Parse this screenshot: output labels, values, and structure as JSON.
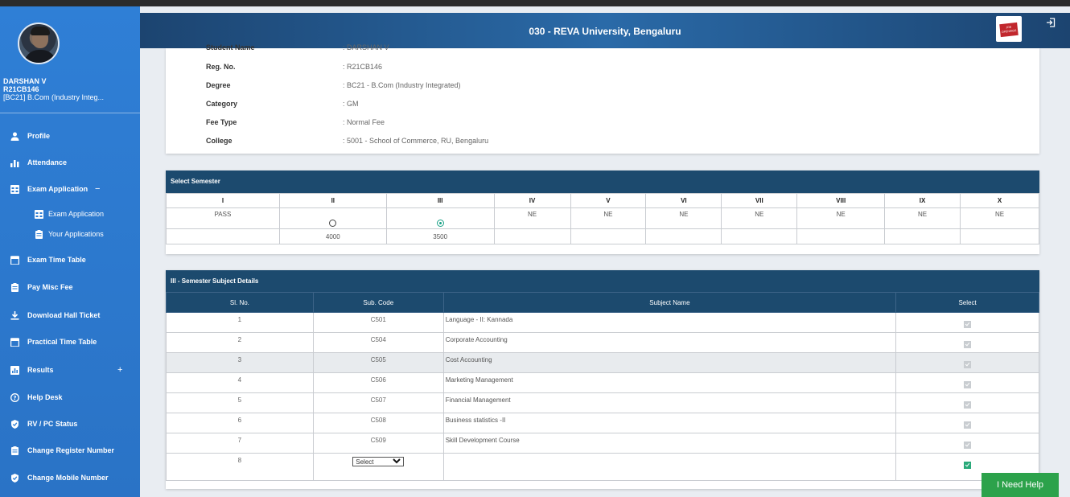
{
  "header": {
    "title": "030 - REVA University, Bengaluru",
    "job_badge": "JOB OPENINGS"
  },
  "user": {
    "name": "DARSHAN V",
    "reg_no": "R21CB146",
    "program": "[BC21] B.Com (Industry Integ..."
  },
  "nav": [
    {
      "label": "Profile",
      "icon": "person-icon"
    },
    {
      "label": "Attendance",
      "icon": "bar-chart-icon"
    },
    {
      "label": "Exam Application",
      "icon": "calendar-grid-icon",
      "toggle": "−"
    },
    {
      "label": "Exam Application",
      "icon": "calendar-grid-icon"
    },
    {
      "label": "Your Applications",
      "icon": "clipboard-icon"
    },
    {
      "label": "Exam Time Table",
      "icon": "calendar-icon"
    },
    {
      "label": "Pay Misc Fee",
      "icon": "clipboard-icon"
    },
    {
      "label": "Download Hall Ticket",
      "icon": "download-icon"
    },
    {
      "label": "Practical Time Table",
      "icon": "calendar-icon"
    },
    {
      "label": "Results",
      "icon": "chart-box-icon",
      "toggle": "+"
    },
    {
      "label": "Help Desk",
      "icon": "question-icon"
    },
    {
      "label": "RV / PC Status",
      "icon": "shield-check-icon"
    },
    {
      "label": "Change Register Number",
      "icon": "clipboard-icon"
    },
    {
      "label": "Change Mobile Number",
      "icon": "shield-check-icon"
    }
  ],
  "student": {
    "rows": [
      {
        "label": "Student Name",
        "value": ": DARSHAN V"
      },
      {
        "label": "Reg. No.",
        "value": ": R21CB146"
      },
      {
        "label": "Degree",
        "value": ": BC21 - B.Com (Industry Integrated)"
      },
      {
        "label": "Category",
        "value": ": GM"
      },
      {
        "label": "Fee Type",
        "value": ": Normal Fee"
      },
      {
        "label": "College",
        "value": ": 5001 - School of Commerce, RU, Bengaluru"
      }
    ]
  },
  "semester": {
    "title": "Select Semester",
    "headers": [
      "I",
      "II",
      "III",
      "IV",
      "V",
      "VI",
      "VII",
      "VIII",
      "IX",
      "X"
    ],
    "status": [
      "PASS",
      "",
      "",
      "NE",
      "NE",
      "NE",
      "NE",
      "NE",
      "NE",
      "NE"
    ],
    "radio_selected": [
      false,
      false,
      true
    ],
    "fees": [
      "",
      "4000",
      "3500",
      "",
      "",
      "",
      "",
      "",
      "",
      ""
    ]
  },
  "subjects": {
    "title": "III - Semester Subject Details",
    "headers": {
      "sl": "Sl. No.",
      "code": "Sub. Code",
      "name": "Subject Name",
      "select": "Select"
    },
    "rows": [
      {
        "sl": "1",
        "code": "C501",
        "name": "Language - II: Kannada",
        "checked": false
      },
      {
        "sl": "2",
        "code": "C504",
        "name": "Corporate Accounting",
        "checked": false
      },
      {
        "sl": "3",
        "code": "C505",
        "name": "Cost Accounting",
        "checked": false
      },
      {
        "sl": "4",
        "code": "C506",
        "name": "Marketing Management",
        "checked": false
      },
      {
        "sl": "5",
        "code": "C507",
        "name": "Financial Management",
        "checked": false
      },
      {
        "sl": "6",
        "code": "C508",
        "name": "Business statistics -II",
        "checked": false
      },
      {
        "sl": "7",
        "code": "C509",
        "name": "Skill Development Course",
        "checked": false
      },
      {
        "sl": "8",
        "code": "",
        "name": "",
        "checked": true
      }
    ],
    "select_value": "Select"
  },
  "help_button": "I Need Help"
}
